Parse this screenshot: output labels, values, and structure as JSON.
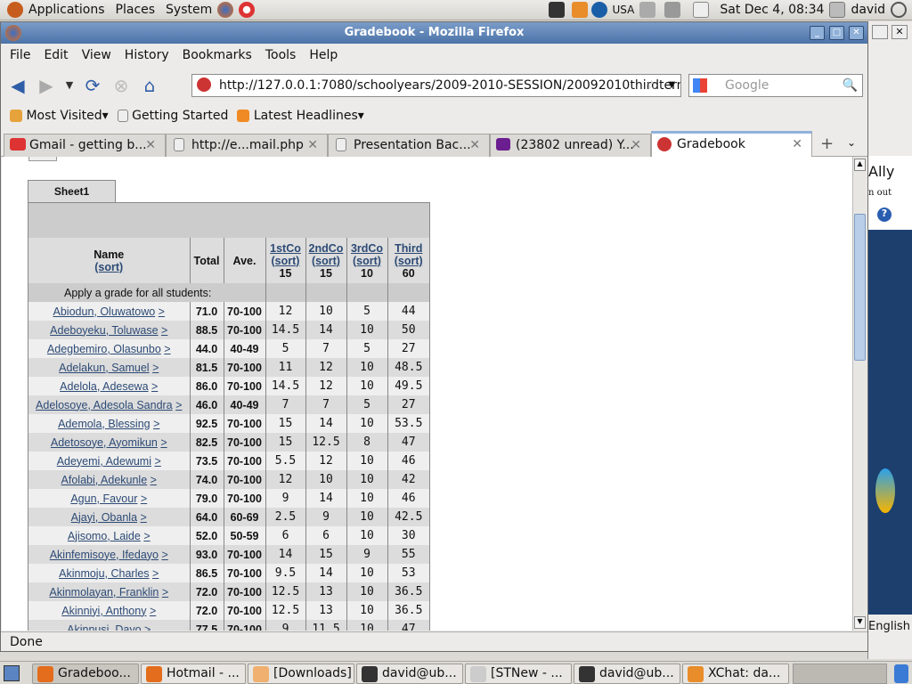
{
  "panel": {
    "menus": [
      "Applications",
      "Places",
      "System"
    ],
    "keyboard": "USA",
    "clock": "Sat Dec  4, 08:34",
    "user": "david"
  },
  "window": {
    "title": "Gradebook - Mozilla Firefox"
  },
  "menu": [
    "File",
    "Edit",
    "View",
    "History",
    "Bookmarks",
    "Tools",
    "Help"
  ],
  "nav": {
    "url": "http://127.0.0.1:7080/schoolyears/2009-2010-SESSION/20092010thirdterm",
    "search_placeholder": "Google"
  },
  "bookmarks": [
    "Most Visited",
    "Getting Started",
    "Latest Headlines"
  ],
  "tabs": [
    {
      "label": "Gmail - getting b..."
    },
    {
      "label": "http://e...mail.php"
    },
    {
      "label": "Presentation Bac..."
    },
    {
      "label": "(23802 unread) Y..."
    },
    {
      "label": "Gradebook"
    }
  ],
  "status": "Done",
  "bgwin": {
    "user": "Ally",
    "signout": "n out",
    "lang": "English"
  },
  "sheet": "Sheet1",
  "table": {
    "headers": {
      "name": "Name",
      "sort": "(sort)",
      "total": "Total",
      "ave": "Ave.",
      "cols": [
        {
          "label": "1stCo",
          "max": "15"
        },
        {
          "label": "2ndCo",
          "max": "15"
        },
        {
          "label": "3rdCo",
          "max": "10"
        },
        {
          "label": "Third",
          "max": "60"
        }
      ]
    },
    "apply_label": "Apply a grade for all students:",
    "rows": [
      [
        "Abiodun, Oluwatowo",
        "71.0",
        "70-100",
        "12",
        "10",
        "5",
        "44"
      ],
      [
        "Adeboyeku, Toluwase",
        "88.5",
        "70-100",
        "14.5",
        "14",
        "10",
        "50"
      ],
      [
        "Adegbemiro, Olasunbo",
        "44.0",
        "40-49",
        "5",
        "7",
        "5",
        "27"
      ],
      [
        "Adelakun, Samuel",
        "81.5",
        "70-100",
        "11",
        "12",
        "10",
        "48.5"
      ],
      [
        "Adelola, Adesewa",
        "86.0",
        "70-100",
        "14.5",
        "12",
        "10",
        "49.5"
      ],
      [
        "Adelosoye, Adesola Sandra",
        "46.0",
        "40-49",
        "7",
        "7",
        "5",
        "27"
      ],
      [
        "Ademola, Blessing",
        "92.5",
        "70-100",
        "15",
        "14",
        "10",
        "53.5"
      ],
      [
        "Adetosoye, Ayomikun",
        "82.5",
        "70-100",
        "15",
        "12.5",
        "8",
        "47"
      ],
      [
        "Adeyemi, Adewumi",
        "73.5",
        "70-100",
        "5.5",
        "12",
        "10",
        "46"
      ],
      [
        "Afolabi, Adekunle",
        "74.0",
        "70-100",
        "12",
        "10",
        "10",
        "42"
      ],
      [
        "Agun, Favour",
        "79.0",
        "70-100",
        "9",
        "14",
        "10",
        "46"
      ],
      [
        "Ajayi, Obanla",
        "64.0",
        "60-69",
        "2.5",
        "9",
        "10",
        "42.5"
      ],
      [
        "Ajisomo, Laide",
        "52.0",
        "50-59",
        "6",
        "6",
        "10",
        "30"
      ],
      [
        "Akinfemisoye, Ifedayo",
        "93.0",
        "70-100",
        "14",
        "15",
        "9",
        "55"
      ],
      [
        "Akinmoju, Charles",
        "86.5",
        "70-100",
        "9.5",
        "14",
        "10",
        "53"
      ],
      [
        "Akinmolayan, Franklin",
        "72.0",
        "70-100",
        "12.5",
        "13",
        "10",
        "36.5"
      ],
      [
        "Akinniyi, Anthony",
        "72.0",
        "70-100",
        "12.5",
        "13",
        "10",
        "36.5"
      ],
      [
        "Akinnusi, Dayo",
        "77.5",
        "70-100",
        "9",
        "11.5",
        "10",
        "47"
      ]
    ]
  },
  "taskbar": [
    "Gradeboo...",
    "Hotmail - ...",
    "[Downloads]",
    "david@ub...",
    "[STNew - ...",
    "david@ub...",
    "XChat: da..."
  ]
}
